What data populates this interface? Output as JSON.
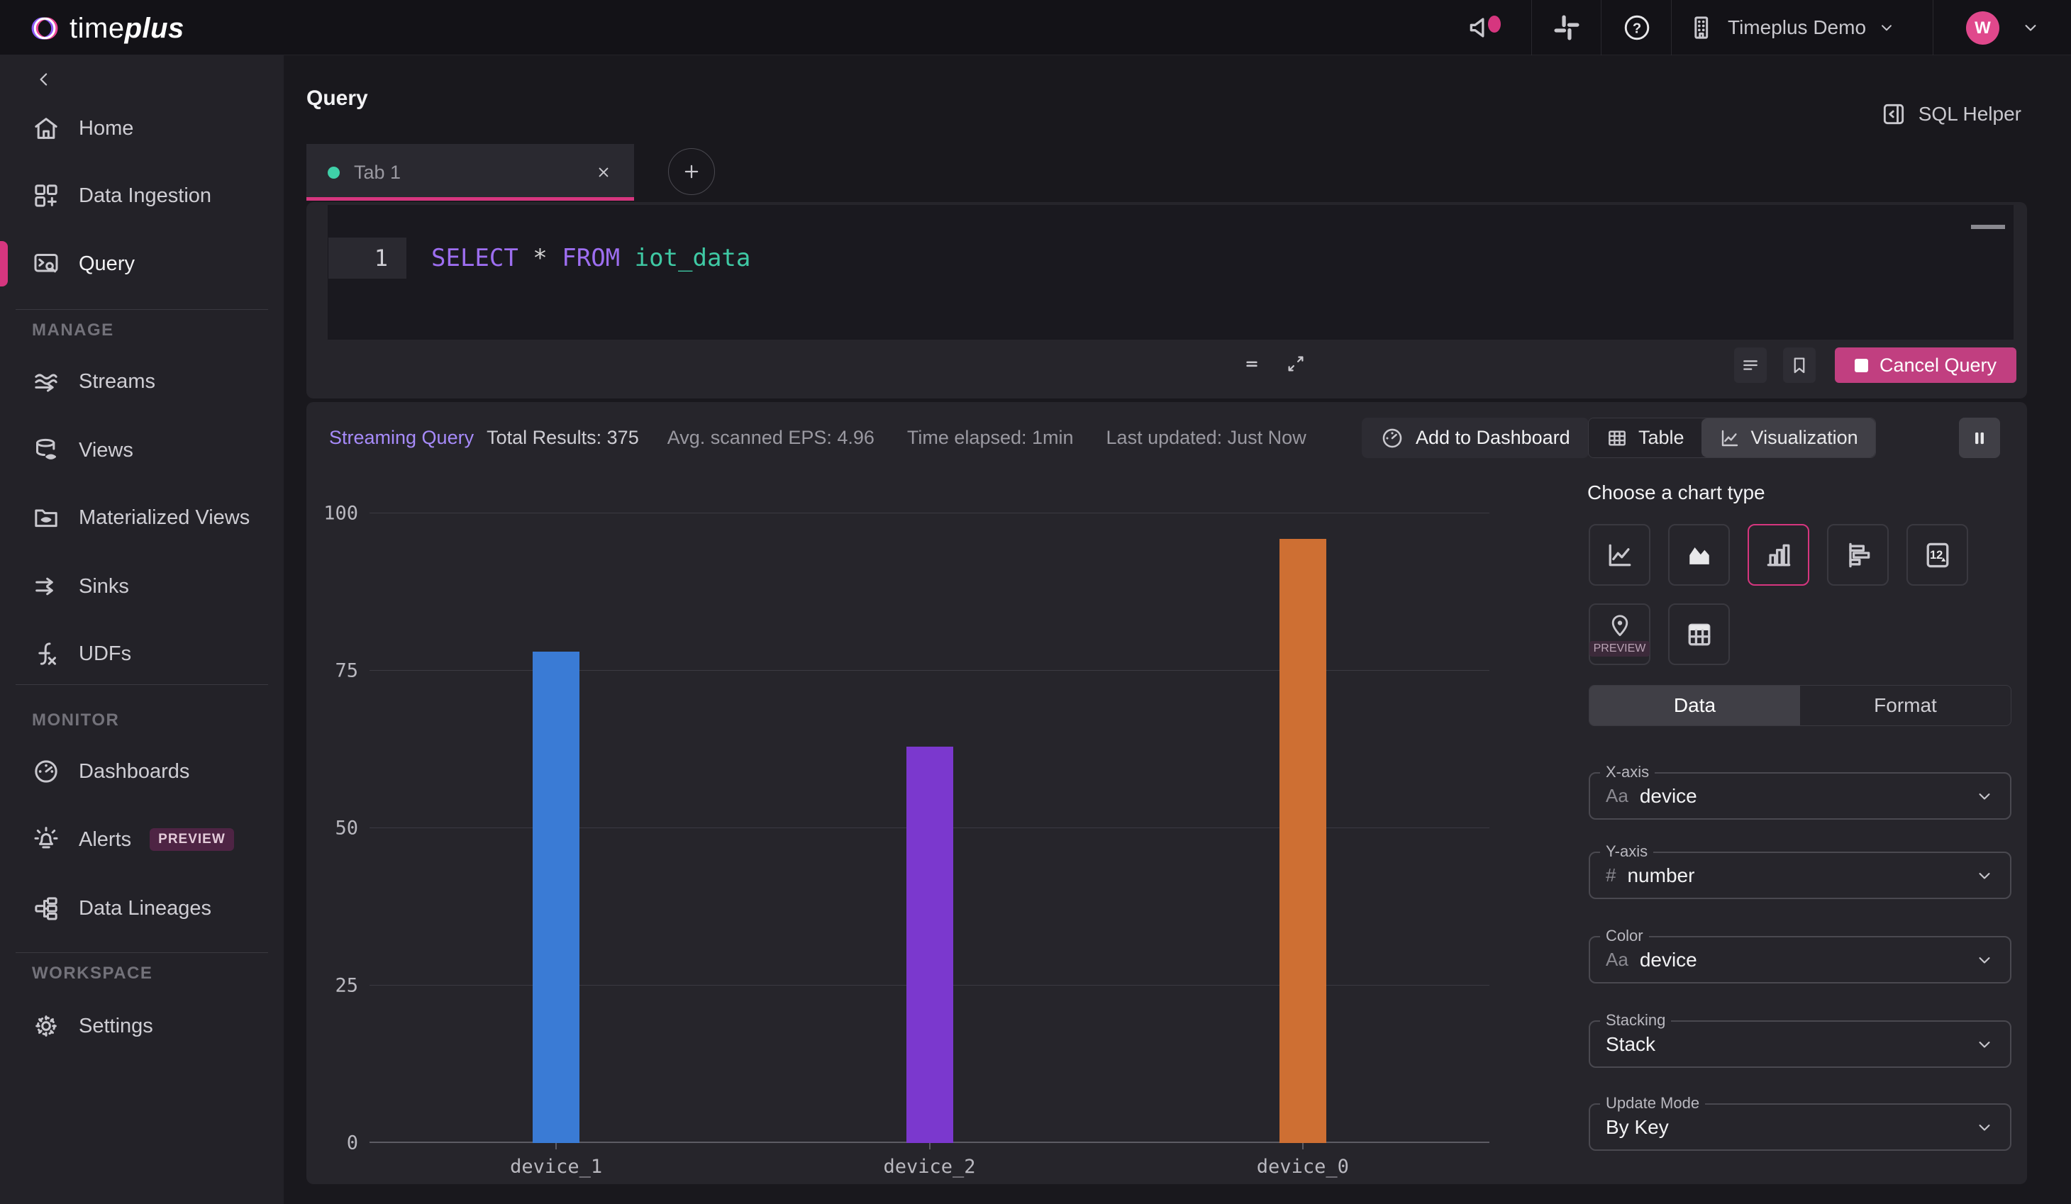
{
  "topbar": {
    "brand": {
      "time": "time",
      "plus": "plus"
    },
    "help_glyph": "?",
    "workspace": {
      "label": "Timeplus Demo"
    },
    "avatar": {
      "initial": "W"
    }
  },
  "sidebar": {
    "sections": [
      {
        "label": "",
        "items": [
          {
            "label": "Home"
          },
          {
            "label": "Data Ingestion"
          },
          {
            "label": "Query"
          }
        ]
      },
      {
        "label": "MANAGE",
        "items": [
          {
            "label": "Streams"
          },
          {
            "label": "Views"
          },
          {
            "label": "Materialized Views"
          },
          {
            "label": "Sinks"
          },
          {
            "label": "UDFs"
          }
        ]
      },
      {
        "label": "MONITOR",
        "items": [
          {
            "label": "Dashboards"
          },
          {
            "label": "Alerts",
            "badge": "PREVIEW"
          },
          {
            "label": "Data Lineages"
          }
        ]
      },
      {
        "label": "WORKSPACE",
        "items": [
          {
            "label": "Settings"
          }
        ]
      }
    ]
  },
  "page": {
    "title": "Query"
  },
  "sql_helper": {
    "label": "SQL Helper"
  },
  "tabs": {
    "active": {
      "label": "Tab 1"
    }
  },
  "editor": {
    "line_number": "1",
    "tokens": [
      {
        "text": "SELECT",
        "type": "keyword"
      },
      {
        "text": " * ",
        "type": "operator"
      },
      {
        "text": "FROM",
        "type": "keyword"
      },
      {
        "text": " iot_data",
        "type": "identifier"
      }
    ]
  },
  "query_controls": {
    "cancel_label": "Cancel Query"
  },
  "stats": {
    "mode": "Streaming Query",
    "total_results": "Total Results: 375",
    "avg_eps": "Avg. scanned EPS: 4.96",
    "time_elapsed": "Time elapsed: 1min",
    "last_updated": "Last updated: Just Now"
  },
  "actions": {
    "add_to_dashboard": "Add to Dashboard",
    "table": "Table",
    "visualization": "Visualization"
  },
  "chart_panel": {
    "title": "Choose a chart type",
    "single_value_glyph": "12",
    "map_preview_label": "PREVIEW",
    "tabs": [
      {
        "label": "Data"
      },
      {
        "label": "Format"
      }
    ],
    "fields": [
      {
        "label": "X-axis",
        "prefix": "Aa",
        "value": "device"
      },
      {
        "label": "Y-axis",
        "prefix": "#",
        "value": "number"
      },
      {
        "label": "Color",
        "prefix": "Aa",
        "value": "device"
      },
      {
        "label": "Stacking",
        "prefix": "",
        "value": "Stack"
      },
      {
        "label": "Update Mode",
        "prefix": "",
        "value": "By Key"
      }
    ]
  },
  "colors": {
    "accent_pink": "#d6367f",
    "streaming_purple": "#a78bfa",
    "tab_dot_teal": "#3fd0a8",
    "cancel_button": "#c13f80"
  },
  "chart_data": {
    "type": "bar",
    "title": "",
    "xlabel": "",
    "ylabel": "",
    "categories": [
      "device_1",
      "device_2",
      "device_0"
    ],
    "values": [
      78,
      63,
      96
    ],
    "colors": [
      "#3a7bd5",
      "#7b38ce",
      "#ce6f33"
    ],
    "ylim": [
      0,
      100
    ],
    "yticks": [
      0,
      25,
      50,
      75,
      100
    ],
    "grid": true,
    "legend": "none"
  }
}
